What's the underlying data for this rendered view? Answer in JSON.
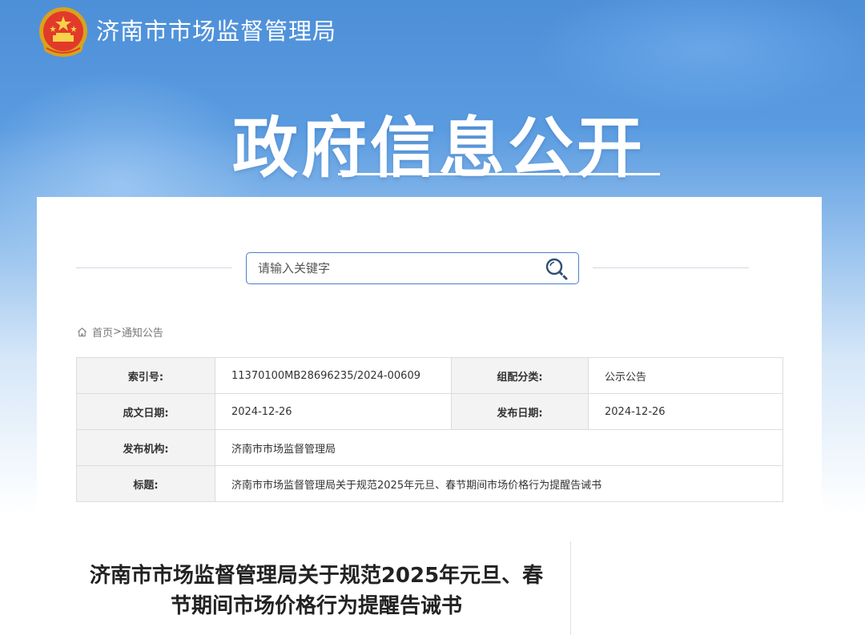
{
  "header": {
    "site_title": "济南市市场监督管理局",
    "hero_title": "政府信息公开"
  },
  "search": {
    "placeholder": "请输入关键字"
  },
  "breadcrumb": {
    "home": "首页",
    "separator": ">",
    "current": "通知公告"
  },
  "meta": {
    "index_label": "索引号:",
    "index_value": "11370100MB28696235/2024-00609",
    "category_label": "组配分类:",
    "category_value": "公示公告",
    "written_date_label": "成文日期:",
    "written_date_value": "2024-12-26",
    "publish_date_label": "发布日期:",
    "publish_date_value": "2024-12-26",
    "publisher_label": "发布机构:",
    "publisher_value": "济南市市场监督管理局",
    "title_label": "标题:",
    "title_value": "济南市市场监督管理局关于规范2025年元旦、春节期间市场价格行为提醒告诫书"
  },
  "article": {
    "title_line1": "济南市市场监督管理局关于规范2025年元旦、春",
    "title_line2": "节期间市场价格行为提醒告诫书"
  },
  "colors": {
    "banner_blue": "#4d8fd8",
    "search_border": "#4a80c8",
    "label_bg": "#f3f3f3"
  },
  "icons": [
    "national-emblem-icon",
    "search-icon",
    "home-icon"
  ]
}
